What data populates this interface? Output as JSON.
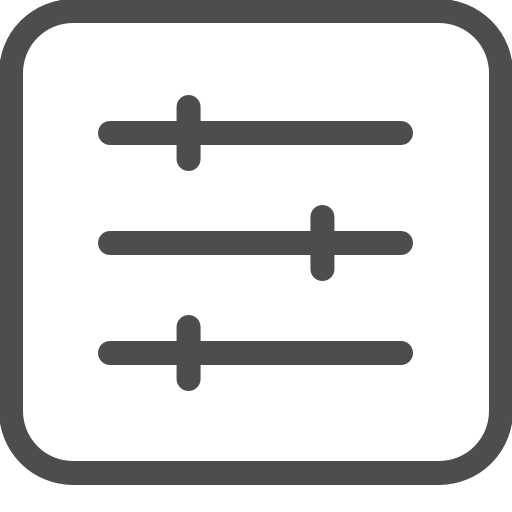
{
  "icon": {
    "name": "sliders-settings-icon",
    "color": "#4d4d4d",
    "background": "#ffffff"
  },
  "sliders": [
    {
      "name": "slider-top",
      "level": 0.27
    },
    {
      "name": "slider-middle",
      "level": 0.73
    },
    {
      "name": "slider-bottom",
      "level": 0.27
    }
  ]
}
